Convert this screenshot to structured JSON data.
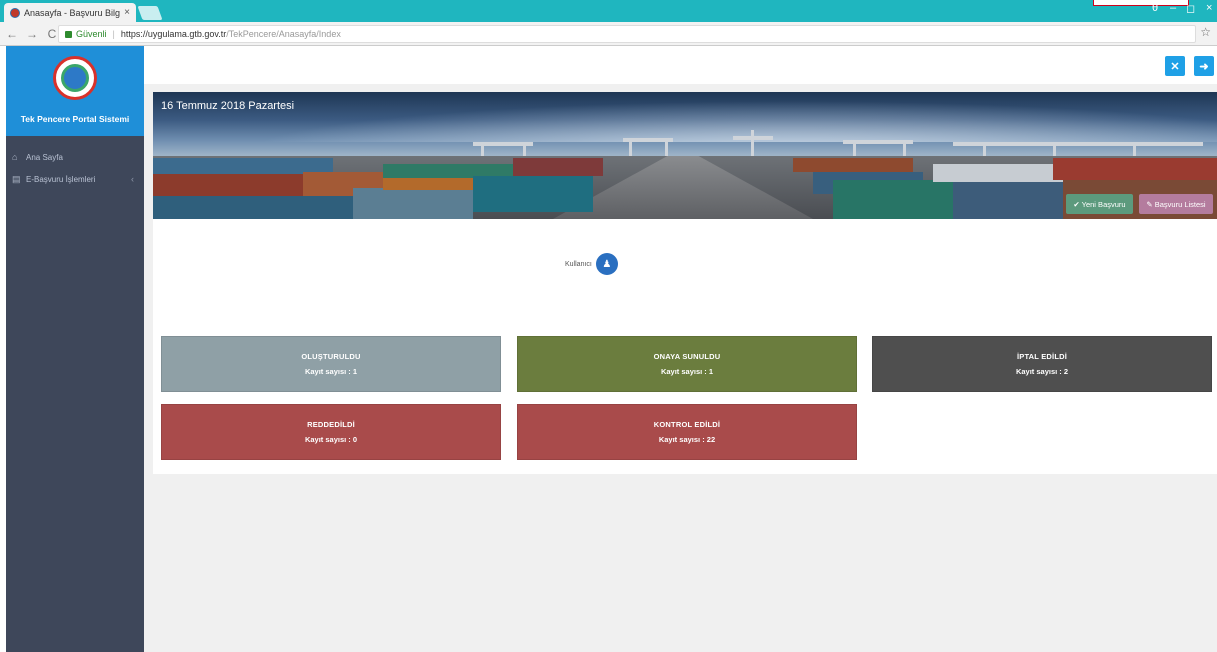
{
  "browser": {
    "tab_title": "Anasayfa - Başvuru Bilgi",
    "tab_close": "×",
    "secure_label": "Güvenli",
    "url_host": "https://uygulama.gtb.gov.tr",
    "url_path": "/TekPencere/Anasayfa/Index",
    "back": "←",
    "forward": "→",
    "reload": "C",
    "bookmark": "☆",
    "win_min": "–",
    "win_max": "◻",
    "win_close": "×",
    "profile_icon": "θ"
  },
  "sidebar": {
    "brand": "Tek Pencere Portal Sistemi",
    "items": [
      {
        "icon": "home-icon",
        "glyph": "⌂",
        "label": "Ana Sayfa"
      },
      {
        "icon": "chart-icon",
        "glyph": "▤",
        "label": "E-Başvuru İşlemleri",
        "chevron": "‹"
      }
    ]
  },
  "topbar": {
    "fullscreen_glyph": "✕",
    "logout_glyph": "➜"
  },
  "banner": {
    "date": "16 Temmuz 2018 Pazartesi",
    "new_application": "✔ Yeni Başvuru",
    "application_list": "✎ Başvuru Listesi"
  },
  "user": {
    "label": "Kullanıcı",
    "glyph": "♟"
  },
  "cards": [
    {
      "title": "OLUŞTURULDU",
      "count": "Kayıt sayısı : 1",
      "color": "#8fa0a6"
    },
    {
      "title": "ONAYA SUNULDU",
      "count": "Kayıt sayısı : 1",
      "color": "#6b7d3e"
    },
    {
      "title": "İPTAL EDİLDİ",
      "count": "Kayıt sayısı : 2",
      "color": "#4f4f4f"
    },
    {
      "title": "REDDEDİLDİ",
      "count": "Kayıt sayısı : 0",
      "color": "#a94b4b"
    },
    {
      "title": "KONTROL EDİLDİ",
      "count": "Kayıt sayısı : 22",
      "color": "#a94b4b"
    }
  ],
  "colors": {
    "accent": "#1fa0e6",
    "sidebar_bg": "#3e475a",
    "sidebar_head": "#1f8fd8",
    "btn_green": "#5c9a7d",
    "btn_pink": "#b47c9e"
  }
}
